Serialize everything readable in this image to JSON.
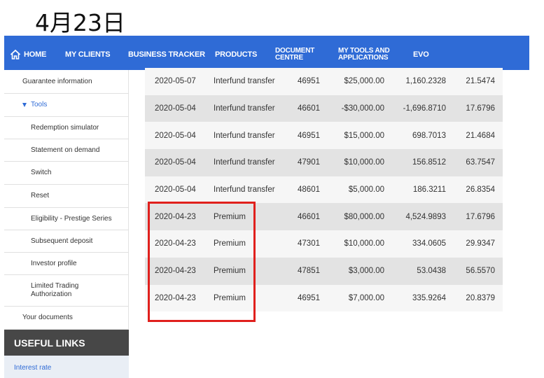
{
  "heading": "4月23日",
  "nav": {
    "home": "HOME",
    "my_clients": "MY CLIENTS",
    "business_tracker": "BUSINESS TRACKER",
    "products": "PRODUCTS",
    "document_centre_1": "DOCUMENT",
    "document_centre_2": "CENTRE",
    "my_tools_1": "MY TOOLS AND",
    "my_tools_2": "APPLICATIONS",
    "evo": "EVO"
  },
  "sidebar": {
    "items": [
      {
        "label": "Guarantee information"
      },
      {
        "label": "Tools"
      },
      {
        "label": "Redemption simulator"
      },
      {
        "label": "Statement on demand"
      },
      {
        "label": "Switch"
      },
      {
        "label": "Reset"
      },
      {
        "label": "Eligibility - Prestige Series"
      },
      {
        "label": "Subsequent deposit"
      },
      {
        "label": "Investor profile"
      },
      {
        "label": "Limited Trading"
      },
      {
        "label": "Authorization"
      },
      {
        "label": "Your documents"
      }
    ],
    "useful_links": "USEFUL LINKS",
    "interest_rate": "Interest rate"
  },
  "transactions": [
    {
      "date": "2020-05-07",
      "type": "Interfund transfer",
      "code": "46951",
      "amount": "$25,000.00",
      "units": "1,160.2328",
      "price": "21.5474"
    },
    {
      "date": "2020-05-04",
      "type": "Interfund transfer",
      "code": "46601",
      "amount": "-$30,000.00",
      "units": "-1,696.8710",
      "price": "17.6796"
    },
    {
      "date": "2020-05-04",
      "type": "Interfund transfer",
      "code": "46951",
      "amount": "$15,000.00",
      "units": "698.7013",
      "price": "21.4684"
    },
    {
      "date": "2020-05-04",
      "type": "Interfund transfer",
      "code": "47901",
      "amount": "$10,000.00",
      "units": "156.8512",
      "price": "63.7547"
    },
    {
      "date": "2020-05-04",
      "type": "Interfund transfer",
      "code": "48601",
      "amount": "$5,000.00",
      "units": "186.3211",
      "price": "26.8354"
    },
    {
      "date": "2020-04-23",
      "type": "Premium",
      "code": "46601",
      "amount": "$80,000.00",
      "units": "4,524.9893",
      "price": "17.6796"
    },
    {
      "date": "2020-04-23",
      "type": "Premium",
      "code": "47301",
      "amount": "$10,000.00",
      "units": "334.0605",
      "price": "29.9347"
    },
    {
      "date": "2020-04-23",
      "type": "Premium",
      "code": "47851",
      "amount": "$3,000.00",
      "units": "53.0438",
      "price": "56.5570"
    },
    {
      "date": "2020-04-23",
      "type": "Premium",
      "code": "46951",
      "amount": "$7,000.00",
      "units": "335.9264",
      "price": "20.8379"
    }
  ],
  "colors": {
    "nav_bg": "#2f6bd6",
    "highlight": "#e0201d",
    "useful_links_bg": "#474747"
  }
}
